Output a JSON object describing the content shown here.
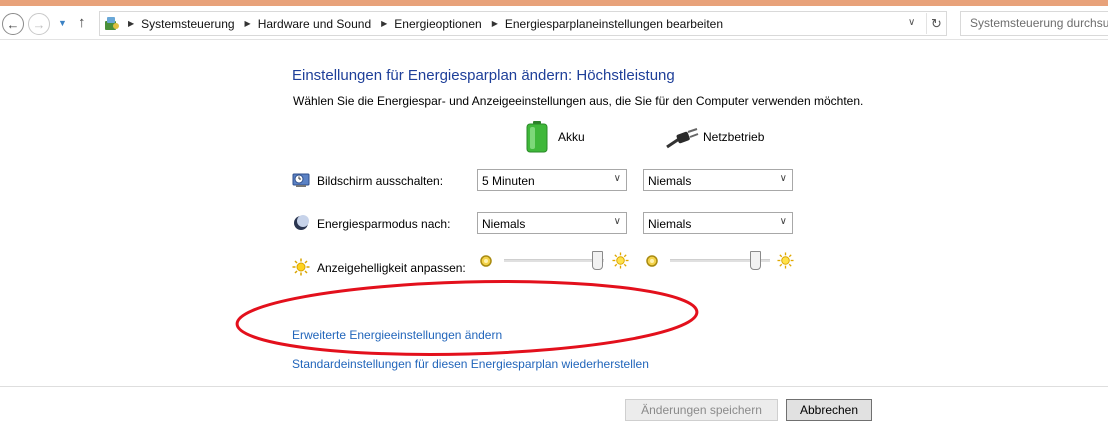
{
  "address_bar": {
    "crumbs": [
      "Systemsteuerung",
      "Hardware und Sound",
      "Energieoptionen",
      "Energiesparplaneinstellungen bearbeiten"
    ]
  },
  "search": {
    "placeholder": "Systemsteuerung durchsuchen"
  },
  "page": {
    "title": "Einstellungen für Energiesparplan ändern: Höchstleistung",
    "subtitle": "Wählen Sie die Energiespar- und Anzeigeeinstellungen aus, die Sie für den Computer verwenden möchten."
  },
  "columns": {
    "battery": "Akku",
    "plugged_in": "Netzbetrieb"
  },
  "settings": {
    "display_off": {
      "label": "Bildschirm ausschalten:",
      "battery_value": "5 Minuten",
      "plugged_value": "Niemals"
    },
    "sleep": {
      "label": "Energiesparmodus nach:",
      "battery_value": "Niemals",
      "plugged_value": "Niemals"
    },
    "brightness": {
      "label": "Anzeigehelligkeit anpassen:",
      "battery_level": 0.93,
      "plugged_level": 0.85
    }
  },
  "links": {
    "advanced": "Erweiterte Energieeinstellungen ändern",
    "restore": "Standardeinstellungen für diesen Energiesparplan wiederherstellen"
  },
  "buttons": {
    "save": "Änderungen speichern",
    "cancel": "Abbrechen"
  },
  "colors": {
    "title": "#1e3f99",
    "link": "#2266bb",
    "annotation": "#e3101c",
    "battery_green": "#3fb83a"
  }
}
